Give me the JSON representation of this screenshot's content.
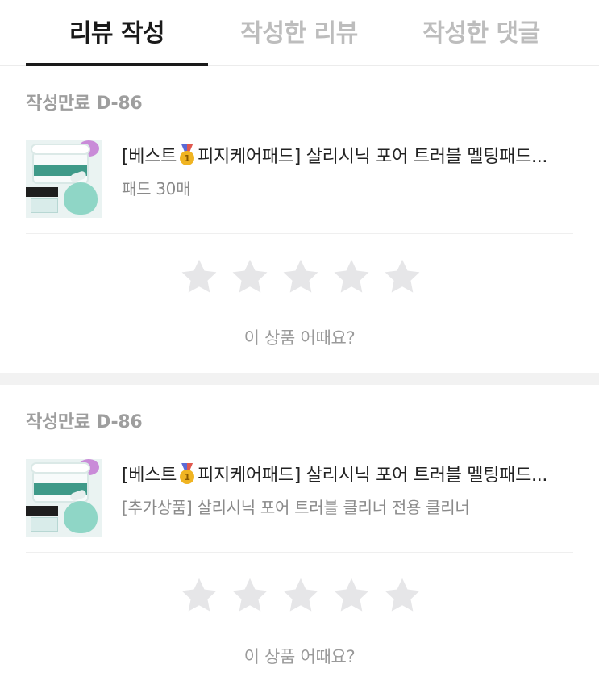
{
  "tabs": [
    {
      "label": "리뷰 작성",
      "active": true
    },
    {
      "label": "작성한 리뷰",
      "active": false
    },
    {
      "label": "작성한 댓글",
      "active": false
    }
  ],
  "reviews": [
    {
      "deadline": "작성만료 D-86",
      "name_before": "[베스트",
      "name_after": "피지케어패드] 살리시닉 포어 트러블 멜팅패드...",
      "option": "패드 30매",
      "rating_prompt": "이 상품 어때요?",
      "stars_total": 5,
      "stars_selected": 0
    },
    {
      "deadline": "작성만료 D-86",
      "name_before": "[베스트",
      "name_after": "피지케어패드] 살리시닉 포어 트러블 멜팅패드...",
      "option": "[추가상품] 살리시닉 포어 트러블 클리너 전용 클리너",
      "rating_prompt": "이 상품 어때요?",
      "stars_total": 5,
      "stars_selected": 0
    }
  ],
  "colors": {
    "active_tab": "#1a1a1a",
    "inactive_tab": "#bdbdbd",
    "star_empty": "#e6e6e8",
    "section_gap": "#f2f2f2"
  },
  "icons": {
    "medal": "gold-medal-1-icon",
    "star": "star-icon"
  }
}
